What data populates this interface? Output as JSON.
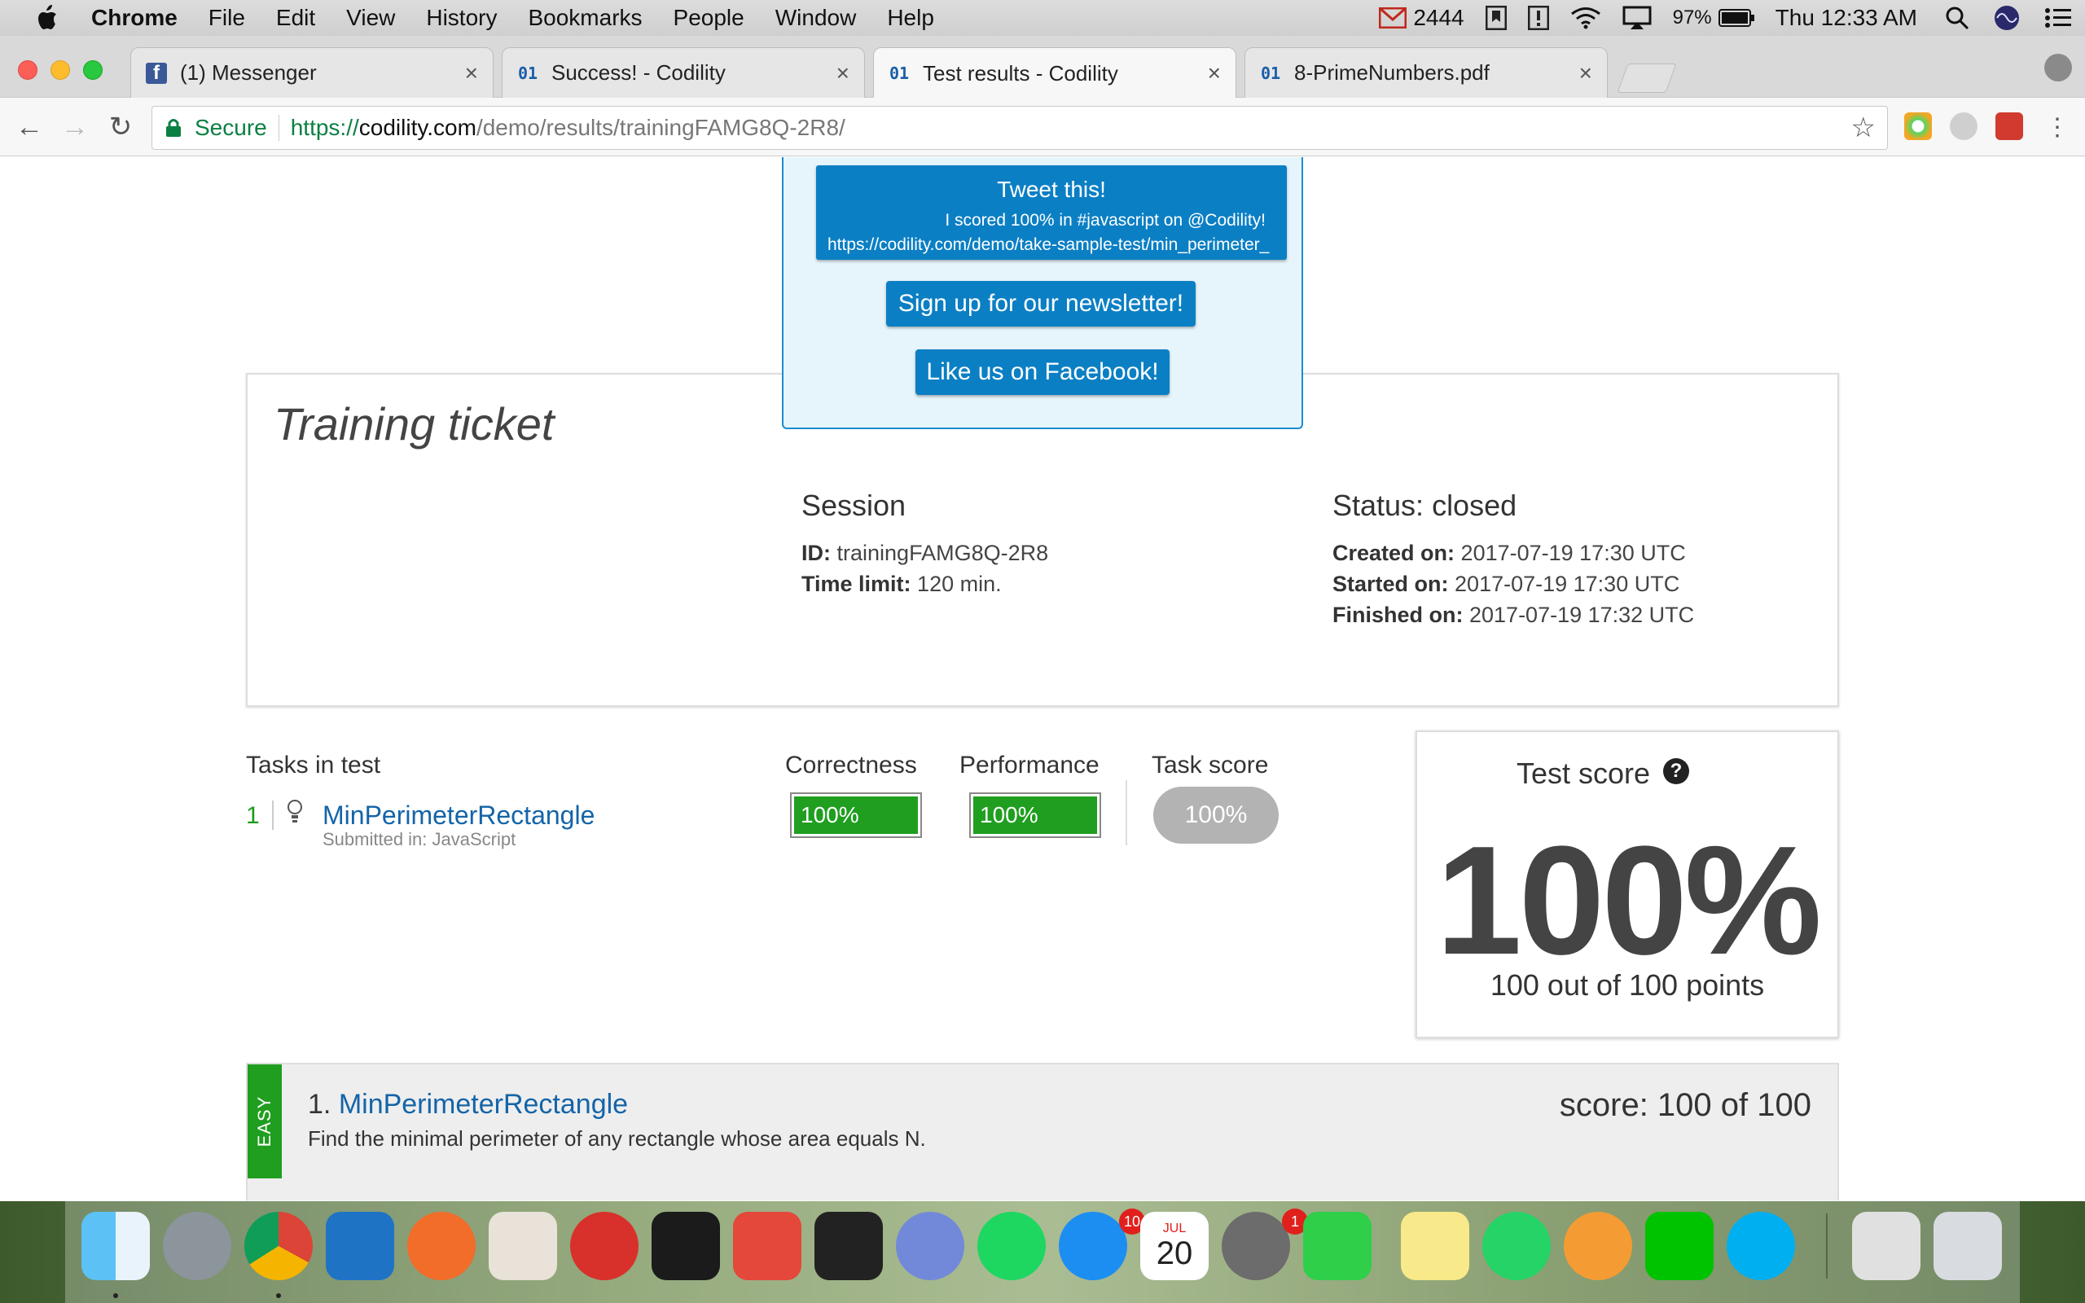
{
  "menubar": {
    "app_name": "Chrome",
    "items": [
      "File",
      "Edit",
      "View",
      "History",
      "Bookmarks",
      "People",
      "Window",
      "Help"
    ],
    "mail_count": "2444",
    "battery": "97%",
    "clock": "Thu 12:33 AM"
  },
  "tabs": [
    {
      "title": "(1) Messenger",
      "icon": "facebook-icon"
    },
    {
      "title": "Success! - Codility",
      "icon": "codility-icon"
    },
    {
      "title": "Test results - Codility",
      "icon": "codility-icon"
    },
    {
      "title": "8-PrimeNumbers.pdf",
      "icon": "codility-icon"
    }
  ],
  "address_bar": {
    "secure_label": "Secure",
    "scheme": "https://",
    "host": "codility.com",
    "path": "/demo/results/trainingFAMG8Q-2R8/"
  },
  "social": {
    "tweet_title": "Tweet this!",
    "tweet_line1": "I scored 100% in #javascript on @Codility!",
    "tweet_line2": "https://codility.com/demo/take-sample-test/min_perimeter_",
    "newsletter": "Sign up for our newsletter!",
    "facebook": "Like us on Facebook!"
  },
  "ticket": {
    "title": "Training ticket",
    "session_head": "Session",
    "id_label": "ID:",
    "id_value": "trainingFAMG8Q-2R8",
    "time_limit_label": "Time limit:",
    "time_limit_value": "120 min.",
    "status_head": "Status: closed",
    "created_label": "Created on:",
    "created_value": "2017-07-19 17:30 UTC",
    "started_label": "Started on:",
    "started_value": "2017-07-19 17:30 UTC",
    "finished_label": "Finished on:",
    "finished_value": "2017-07-19 17:32 UTC"
  },
  "tasks": {
    "head": "Tasks in test",
    "correctness_head": "Correctness",
    "performance_head": "Performance",
    "task_score_head": "Task score",
    "items": [
      {
        "num": "1",
        "name": "MinPerimeterRectangle",
        "submitted": "Submitted in: JavaScript",
        "correctness": "100%",
        "correctness_fraction": 1.0,
        "performance": "100%",
        "performance_fraction": 1.0,
        "task_score": "100%"
      }
    ]
  },
  "test_score": {
    "label": "Test score",
    "help": "?",
    "value": "100%",
    "points": "100 out of 100 points"
  },
  "task_detail": {
    "difficulty": "EASY",
    "prefix": "1.",
    "name": "MinPerimeterRectangle",
    "description": "Find the minimal perimeter of any rectangle whose area equals N.",
    "score": "score: 100 of 100"
  },
  "dock": {
    "appstore_badge": "10",
    "calendar_month": "JUL",
    "calendar_day": "20",
    "prefs_badge": "1"
  },
  "colors": {
    "accent_blue": "#0b7fc4",
    "link_blue": "#1464a8",
    "success_green": "#1f9e1f",
    "secure_green": "#0b8043"
  }
}
